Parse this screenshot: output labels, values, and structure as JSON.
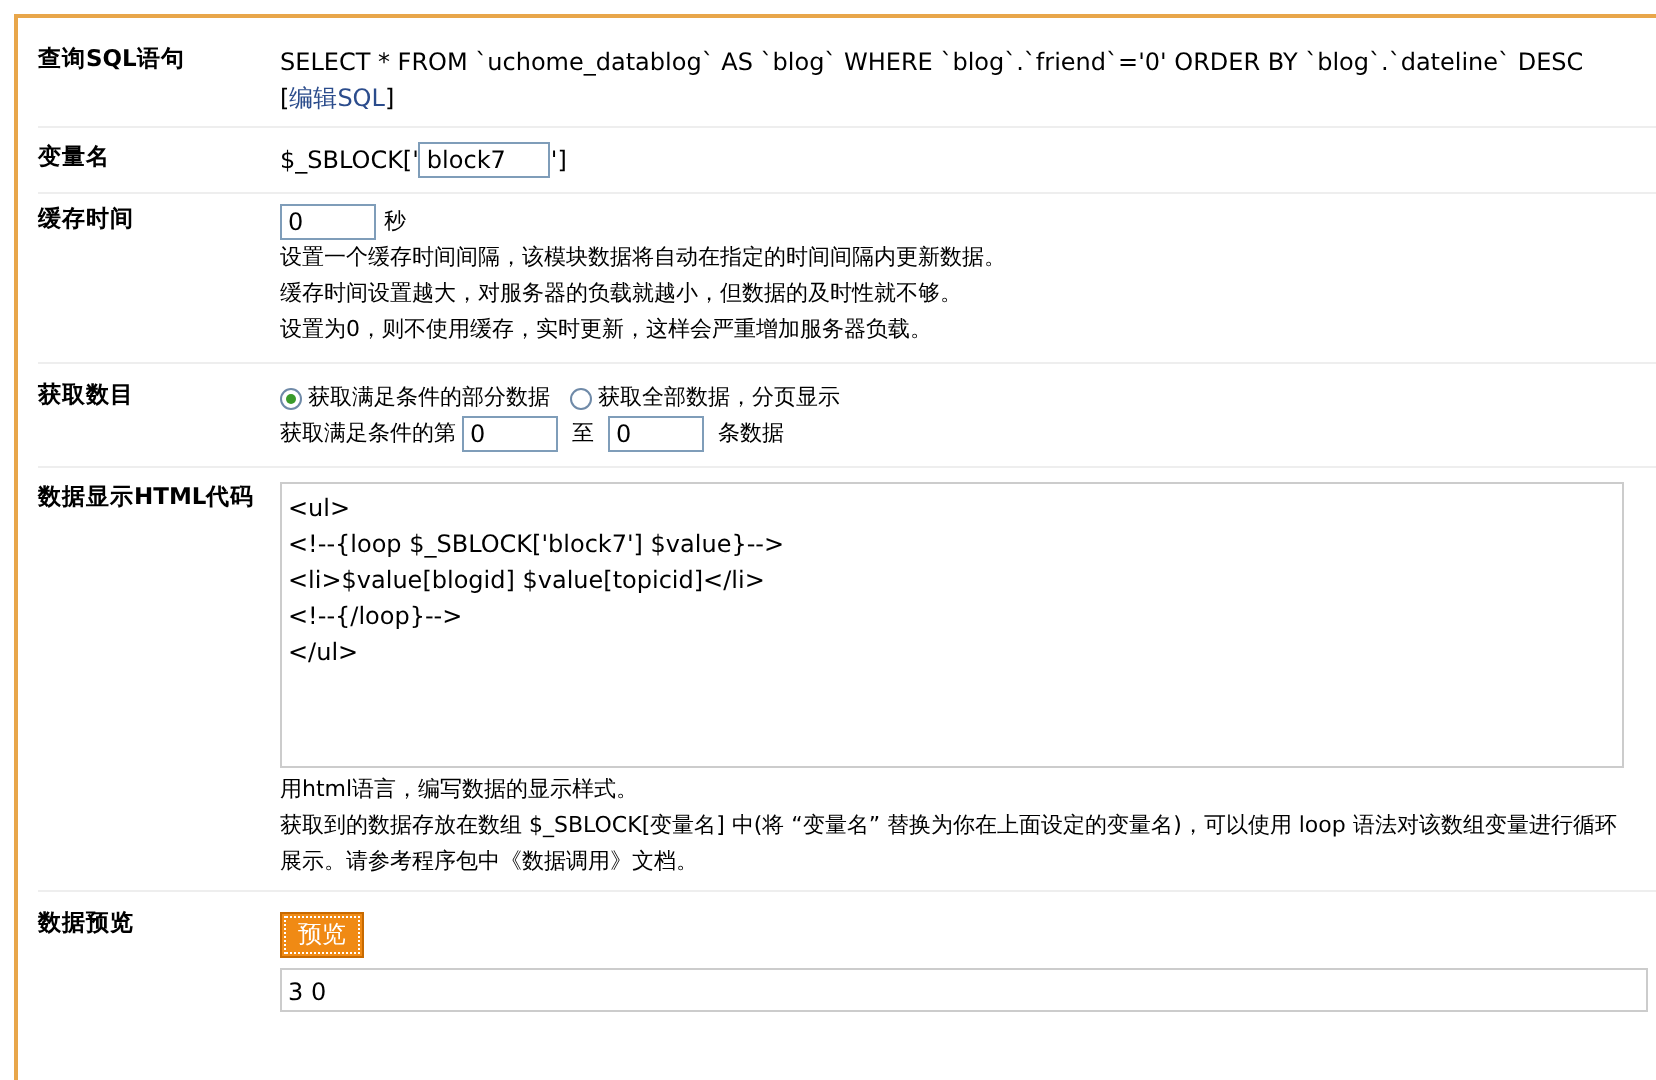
{
  "sql_row": {
    "label": "查询SQL语句",
    "sql": "SELECT * FROM `uchome_datablog` AS `blog` WHERE `blog`.`friend`='0' ORDER BY `blog`.`dateline` DESC",
    "bracket_open": "[",
    "link": "编辑SQL",
    "bracket_close": "]"
  },
  "variable_row": {
    "label": "变量名",
    "prefix": "$_SBLOCK['",
    "value": "block7",
    "suffix": "']"
  },
  "cache_row": {
    "label": "缓存时间",
    "value": "0",
    "unit": "秒",
    "help": [
      "设置一个缓存时间间隔，该模块数据将自动在指定的时间间隔内更新数据。",
      "缓存时间设置越大，对服务器的负载就越小，但数据的及时性就不够。",
      "设置为0，则不使用缓存，实时更新，这样会严重增加服务器负载。"
    ]
  },
  "count_row": {
    "label": "获取数目",
    "options": [
      {
        "label": "获取满足条件的部分数据",
        "selected": true
      },
      {
        "label": "获取全部数据，分页显示",
        "selected": false
      }
    ],
    "range_prefix": "获取满足条件的第",
    "start": "0",
    "range_mid": "至",
    "end": "0",
    "range_suffix": "条数据"
  },
  "html_row": {
    "label": "数据显示HTML代码",
    "code": "<ul>\n<!--{loop $_SBLOCK['block7'] $value}-->\n<li>$value[blogid] $value[topicid]</li>\n<!--{/loop}-->\n</ul>",
    "help": [
      "用html语言，编写数据的显示样式。",
      "获取到的数据存放在数组 $_SBLOCK[变量名] 中(将 “变量名” 替换为你在上面设定的变量名)，可以使用 loop 语法对该数组变量进行循环展示。请参考程序包中《数据调用》文档。"
    ]
  },
  "preview_row": {
    "label": "数据预览",
    "button": "预览",
    "output": "3 0"
  }
}
